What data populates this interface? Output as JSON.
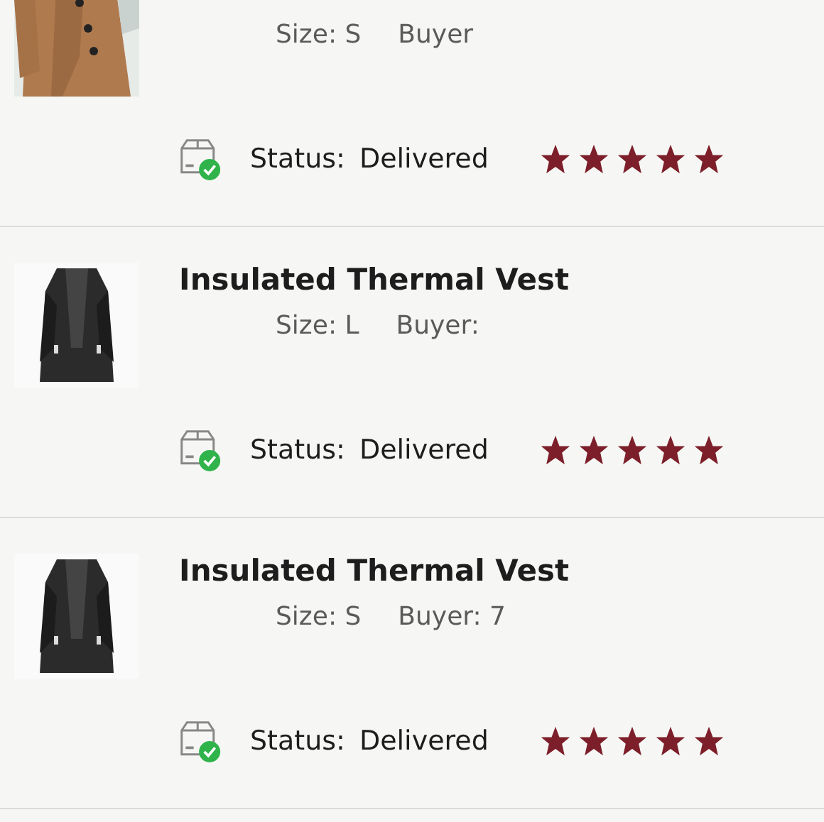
{
  "orders": [
    {
      "kind": "coat",
      "size": "Size: S",
      "buyer": "Buyer",
      "status_label": "Status:",
      "status": "Delivered",
      "stars": 5
    },
    {
      "kind": "vest",
      "title": "Insulated Thermal Vest",
      "size": "Size: L",
      "buyer": "Buyer:",
      "status_label": "Status:",
      "status": "Delivered",
      "stars": 5
    },
    {
      "kind": "vest",
      "title": "Insulated Thermal Vest",
      "size": "Size: S",
      "buyer": "Buyer: 7",
      "status_label": "Status:",
      "status": "Delivered",
      "stars": 5
    }
  ]
}
